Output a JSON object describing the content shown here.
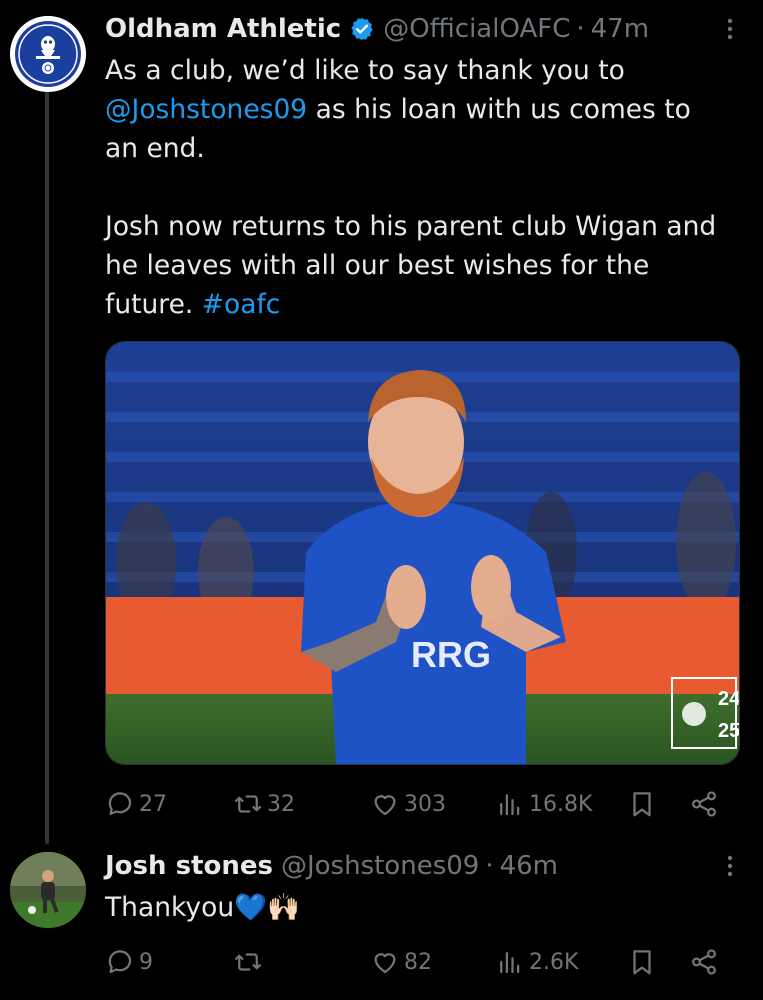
{
  "tweet1": {
    "name": "Oldham Athletic",
    "handle": "@OfficialOAFC",
    "separator": "·",
    "time": "47m",
    "line1": "As a club, we’d like to say thank you to",
    "mention": "@Joshstones09",
    "line2_rest": " as his loan with us comes to",
    "line3": "an end.",
    "para2_line1": "Josh now returns to his parent club Wigan and",
    "para2_line2": "he leaves with all our best wishes for the",
    "para2_line3_start": "future. ",
    "hashtag": "#oafc",
    "image": {
      "shirt_sponsor": "RRG",
      "season_badge_top": "24",
      "season_badge_bottom": "25"
    },
    "stats": {
      "replies": "27",
      "reposts": "32",
      "likes": "303",
      "views": "16.8K"
    }
  },
  "tweet2": {
    "name": "Josh stones",
    "handle": "@Joshstones09",
    "separator": "·",
    "time": "46m",
    "text": "Thankyou💙🙌🏻",
    "stats": {
      "replies": "9",
      "reposts": "",
      "likes": "82",
      "views": "2.6K"
    }
  },
  "colors": {
    "background": "#000000",
    "text": "#e7e9ea",
    "muted": "#71767b",
    "link": "#1d9bf0",
    "verified": "#1d9bf0"
  }
}
